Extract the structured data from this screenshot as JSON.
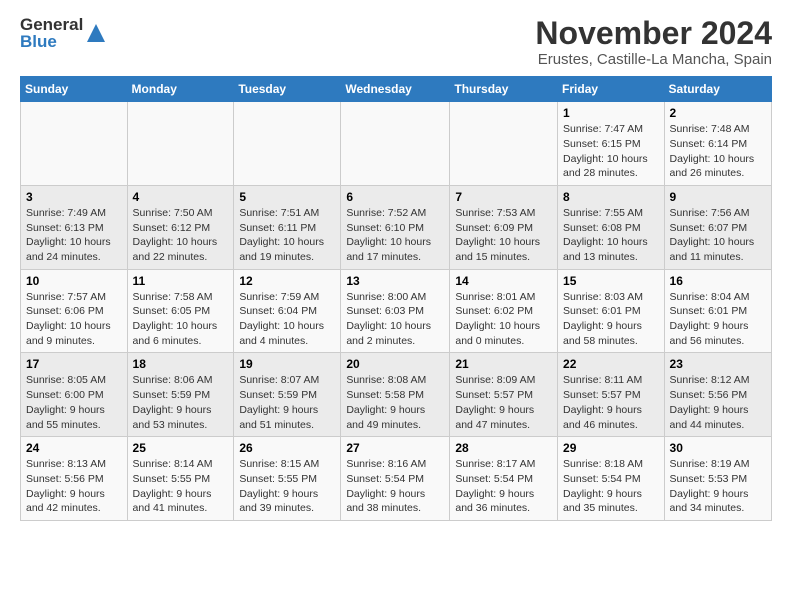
{
  "header": {
    "logo_line1": "General",
    "logo_line2": "Blue",
    "month": "November 2024",
    "location": "Erustes, Castille-La Mancha, Spain"
  },
  "days_of_week": [
    "Sunday",
    "Monday",
    "Tuesday",
    "Wednesday",
    "Thursday",
    "Friday",
    "Saturday"
  ],
  "weeks": [
    [
      {
        "day": "",
        "info": ""
      },
      {
        "day": "",
        "info": ""
      },
      {
        "day": "",
        "info": ""
      },
      {
        "day": "",
        "info": ""
      },
      {
        "day": "",
        "info": ""
      },
      {
        "day": "1",
        "info": "Sunrise: 7:47 AM\nSunset: 6:15 PM\nDaylight: 10 hours and 28 minutes."
      },
      {
        "day": "2",
        "info": "Sunrise: 7:48 AM\nSunset: 6:14 PM\nDaylight: 10 hours and 26 minutes."
      }
    ],
    [
      {
        "day": "3",
        "info": "Sunrise: 7:49 AM\nSunset: 6:13 PM\nDaylight: 10 hours and 24 minutes."
      },
      {
        "day": "4",
        "info": "Sunrise: 7:50 AM\nSunset: 6:12 PM\nDaylight: 10 hours and 22 minutes."
      },
      {
        "day": "5",
        "info": "Sunrise: 7:51 AM\nSunset: 6:11 PM\nDaylight: 10 hours and 19 minutes."
      },
      {
        "day": "6",
        "info": "Sunrise: 7:52 AM\nSunset: 6:10 PM\nDaylight: 10 hours and 17 minutes."
      },
      {
        "day": "7",
        "info": "Sunrise: 7:53 AM\nSunset: 6:09 PM\nDaylight: 10 hours and 15 minutes."
      },
      {
        "day": "8",
        "info": "Sunrise: 7:55 AM\nSunset: 6:08 PM\nDaylight: 10 hours and 13 minutes."
      },
      {
        "day": "9",
        "info": "Sunrise: 7:56 AM\nSunset: 6:07 PM\nDaylight: 10 hours and 11 minutes."
      }
    ],
    [
      {
        "day": "10",
        "info": "Sunrise: 7:57 AM\nSunset: 6:06 PM\nDaylight: 10 hours and 9 minutes."
      },
      {
        "day": "11",
        "info": "Sunrise: 7:58 AM\nSunset: 6:05 PM\nDaylight: 10 hours and 6 minutes."
      },
      {
        "day": "12",
        "info": "Sunrise: 7:59 AM\nSunset: 6:04 PM\nDaylight: 10 hours and 4 minutes."
      },
      {
        "day": "13",
        "info": "Sunrise: 8:00 AM\nSunset: 6:03 PM\nDaylight: 10 hours and 2 minutes."
      },
      {
        "day": "14",
        "info": "Sunrise: 8:01 AM\nSunset: 6:02 PM\nDaylight: 10 hours and 0 minutes."
      },
      {
        "day": "15",
        "info": "Sunrise: 8:03 AM\nSunset: 6:01 PM\nDaylight: 9 hours and 58 minutes."
      },
      {
        "day": "16",
        "info": "Sunrise: 8:04 AM\nSunset: 6:01 PM\nDaylight: 9 hours and 56 minutes."
      }
    ],
    [
      {
        "day": "17",
        "info": "Sunrise: 8:05 AM\nSunset: 6:00 PM\nDaylight: 9 hours and 55 minutes."
      },
      {
        "day": "18",
        "info": "Sunrise: 8:06 AM\nSunset: 5:59 PM\nDaylight: 9 hours and 53 minutes."
      },
      {
        "day": "19",
        "info": "Sunrise: 8:07 AM\nSunset: 5:59 PM\nDaylight: 9 hours and 51 minutes."
      },
      {
        "day": "20",
        "info": "Sunrise: 8:08 AM\nSunset: 5:58 PM\nDaylight: 9 hours and 49 minutes."
      },
      {
        "day": "21",
        "info": "Sunrise: 8:09 AM\nSunset: 5:57 PM\nDaylight: 9 hours and 47 minutes."
      },
      {
        "day": "22",
        "info": "Sunrise: 8:11 AM\nSunset: 5:57 PM\nDaylight: 9 hours and 46 minutes."
      },
      {
        "day": "23",
        "info": "Sunrise: 8:12 AM\nSunset: 5:56 PM\nDaylight: 9 hours and 44 minutes."
      }
    ],
    [
      {
        "day": "24",
        "info": "Sunrise: 8:13 AM\nSunset: 5:56 PM\nDaylight: 9 hours and 42 minutes."
      },
      {
        "day": "25",
        "info": "Sunrise: 8:14 AM\nSunset: 5:55 PM\nDaylight: 9 hours and 41 minutes."
      },
      {
        "day": "26",
        "info": "Sunrise: 8:15 AM\nSunset: 5:55 PM\nDaylight: 9 hours and 39 minutes."
      },
      {
        "day": "27",
        "info": "Sunrise: 8:16 AM\nSunset: 5:54 PM\nDaylight: 9 hours and 38 minutes."
      },
      {
        "day": "28",
        "info": "Sunrise: 8:17 AM\nSunset: 5:54 PM\nDaylight: 9 hours and 36 minutes."
      },
      {
        "day": "29",
        "info": "Sunrise: 8:18 AM\nSunset: 5:54 PM\nDaylight: 9 hours and 35 minutes."
      },
      {
        "day": "30",
        "info": "Sunrise: 8:19 AM\nSunset: 5:53 PM\nDaylight: 9 hours and 34 minutes."
      }
    ]
  ]
}
